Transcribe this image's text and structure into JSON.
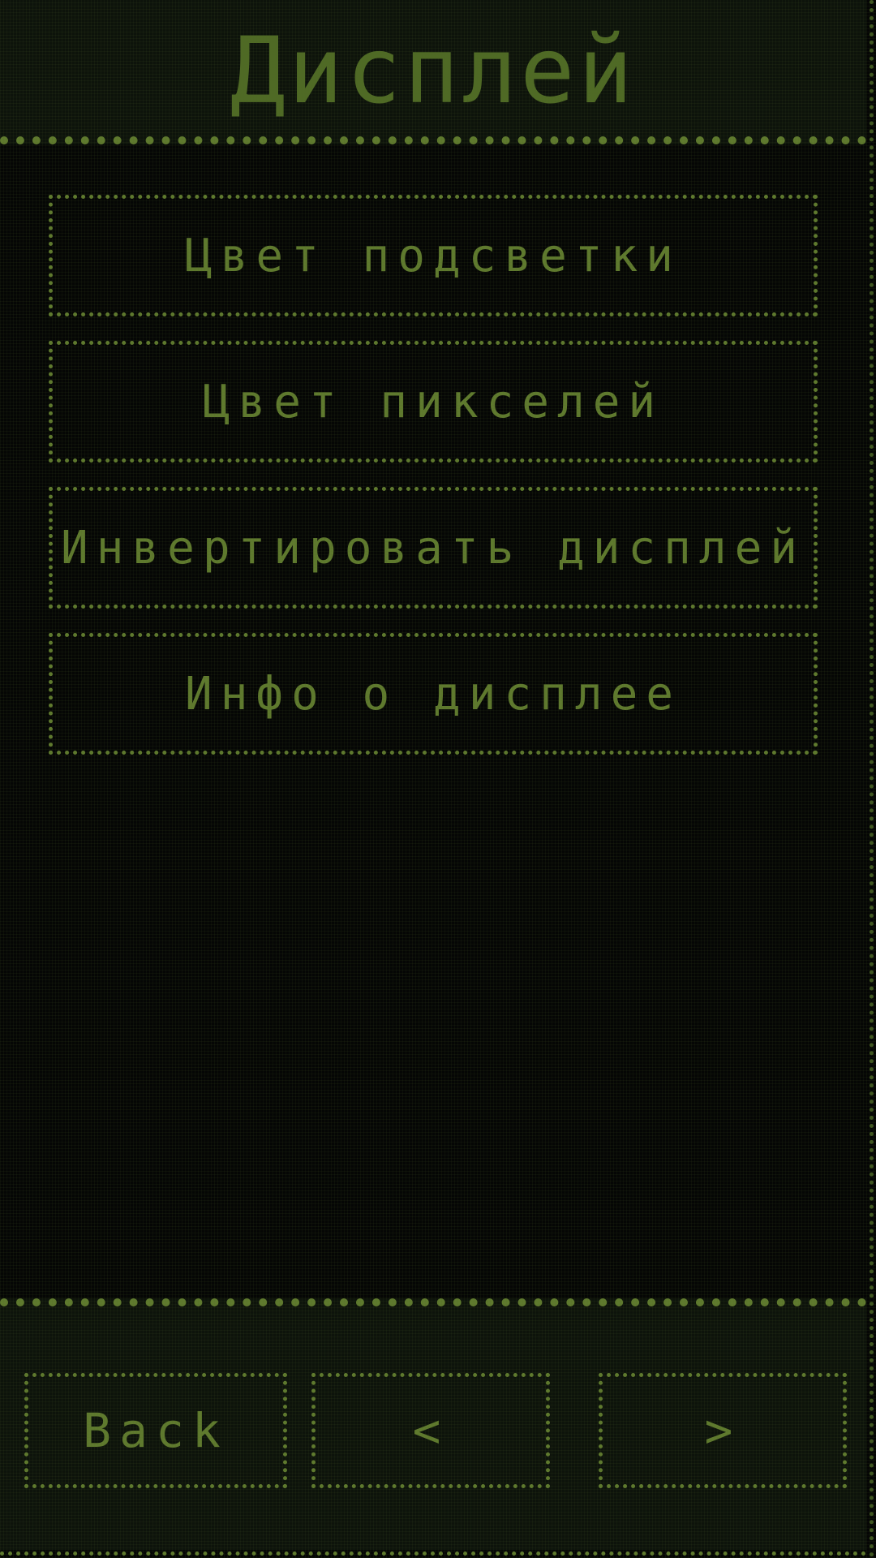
{
  "header": {
    "title": "Дисплей"
  },
  "menu": {
    "items": [
      {
        "label": "Цвет подсветки"
      },
      {
        "label": "Цвет пикселей"
      },
      {
        "label": "Инвертировать дисплей"
      },
      {
        "label": "Инфо о дисплее"
      }
    ]
  },
  "footer": {
    "back_label": "Back",
    "prev_label": "<",
    "next_label": ">"
  },
  "colors": {
    "foreground": "#5f7a2e",
    "background": "#050605",
    "panel": "#0d130b"
  }
}
